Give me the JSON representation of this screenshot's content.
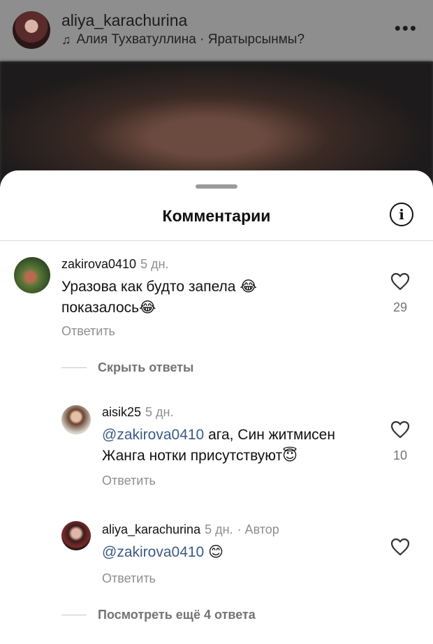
{
  "header": {
    "username": "aliya_karachurina",
    "music_icon": "♫",
    "music": "Алия Тухватуллина · Яратырсынмы?",
    "more_icon": "•••"
  },
  "sheet": {
    "title": "Комментарии",
    "info_icon": "i"
  },
  "comments": [
    {
      "username": "zakirova0410",
      "time": "5 дн.",
      "text": "Уразова как будто запела 😂 показалось😂",
      "reply": "Ответить",
      "likes": "29"
    }
  ],
  "hide_replies": "Скрыть ответы",
  "replies": [
    {
      "username": "aisik25",
      "time": "5 дн.",
      "mention": "@zakirova0410",
      "text": " ага, Син житмисен Жанга нотки присутствуют😇",
      "reply": "Ответить",
      "likes": "10"
    },
    {
      "username": "aliya_karachurina",
      "time": "5 дн.",
      "author": "· Автор",
      "mention": "@zakirova0410",
      "text": " 😊",
      "reply": "Ответить",
      "likes": ""
    }
  ],
  "more_replies": "Посмотреть ещё 4 ответа"
}
